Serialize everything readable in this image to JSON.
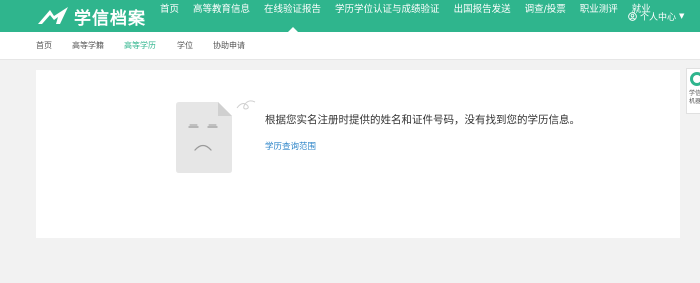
{
  "header": {
    "logo_text": "学信档案",
    "nav": [
      {
        "label": "首页"
      },
      {
        "label": "高等教育信息"
      },
      {
        "label": "在线验证报告"
      },
      {
        "label": "学历学位认证与成绩验证"
      },
      {
        "label": "出国报告发送"
      },
      {
        "label": "调查/投票"
      },
      {
        "label": "职业测评"
      },
      {
        "label": "就业"
      }
    ],
    "active_nav": "在线验证报告",
    "user_center_label": "个人中心"
  },
  "subnav": {
    "items": [
      {
        "label": "首页"
      },
      {
        "label": "高等学籍"
      },
      {
        "label": "高等学历"
      },
      {
        "label": "学位"
      },
      {
        "label": "协助申请"
      }
    ],
    "active": "高等学历"
  },
  "main": {
    "message": "根据您实名注册时提供的姓名和证件号码，没有找到您的学历信息。",
    "scope_link": "学历查询范围"
  },
  "float_widget": {
    "line1": "学信",
    "line2": "机器"
  },
  "colors": {
    "brand_green": "#2fb58d",
    "link_blue": "#2f86c9"
  }
}
